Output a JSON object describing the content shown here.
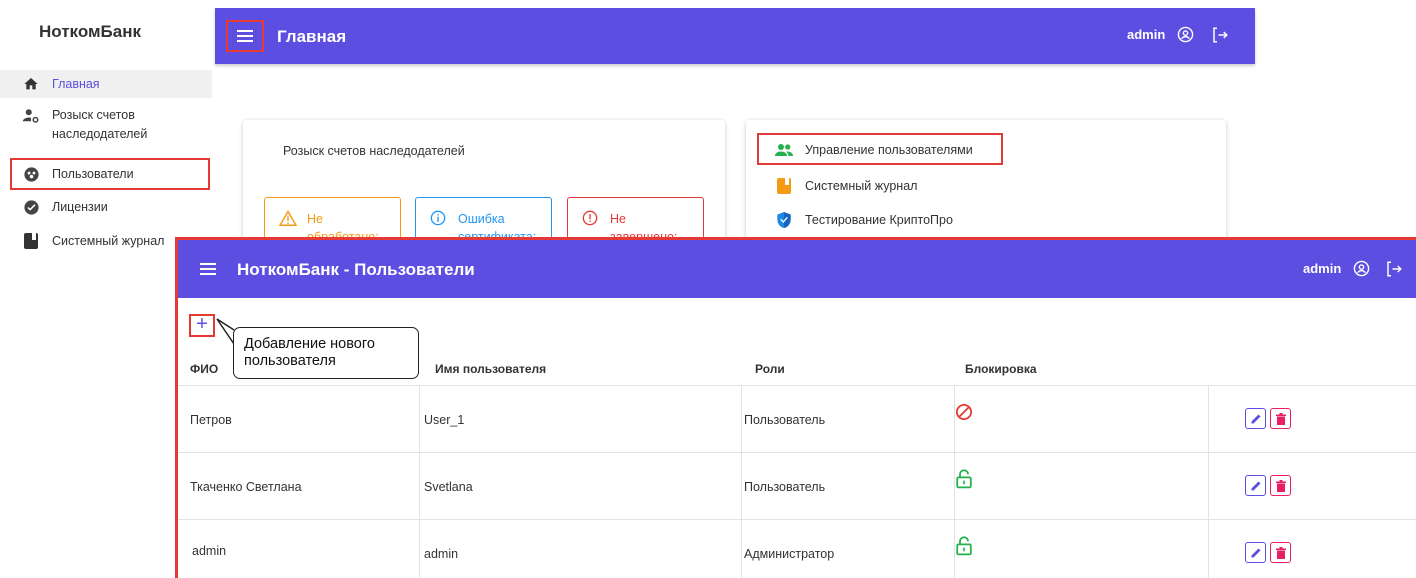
{
  "sidebar": {
    "brand": "НоткомБанк",
    "items": [
      {
        "label": "Главная",
        "icon": "home-icon"
      },
      {
        "label": "Розыск счетов наследодателей",
        "icon": "account-search-icon"
      },
      {
        "label": "Пользователи",
        "icon": "users-icon"
      },
      {
        "label": "Лицензии",
        "icon": "license-icon"
      },
      {
        "label": "Системный журнал",
        "icon": "journal-icon"
      }
    ]
  },
  "main": {
    "title": "Главная",
    "user": "admin",
    "search_card": {
      "title": "Розыск счетов наследодателей",
      "statuses": [
        {
          "label": "Не обработано:",
          "color": "#f39c12"
        },
        {
          "label": "Ошибка сертификата:",
          "color": "#2196f3"
        },
        {
          "label": "Не завершено:",
          "color": "#e53935"
        }
      ]
    },
    "links": [
      {
        "label": "Управление пользователями",
        "icon": "users-icon"
      },
      {
        "label": "Системный журнал",
        "icon": "journal-icon"
      },
      {
        "label": "Тестирование КриптоПро",
        "icon": "shield-icon"
      }
    ]
  },
  "users_window": {
    "title": "НоткомБанк - Пользователи",
    "user": "admin",
    "add_button": "+",
    "callout": "Добавление нового пользователя",
    "columns": [
      "ФИО",
      "Имя пользователя",
      "Роли",
      "Блокировка"
    ],
    "rows": [
      {
        "fio": "Петров",
        "username": "User_1",
        "role": "Пользователь",
        "lock": "blocked"
      },
      {
        "fio": "Ткаченко Светлана",
        "username": "Svetlana",
        "role": "Пользователь",
        "lock": "unlocked"
      },
      {
        "fio": "admin",
        "username": "admin",
        "role": "Администратор",
        "lock": "unlocked"
      }
    ]
  },
  "colors": {
    "accent": "#5b4ee0",
    "highlight": "#e53935",
    "unlocked": "#22b14c",
    "blocked": "#e53935",
    "delete": "#e91e63"
  }
}
